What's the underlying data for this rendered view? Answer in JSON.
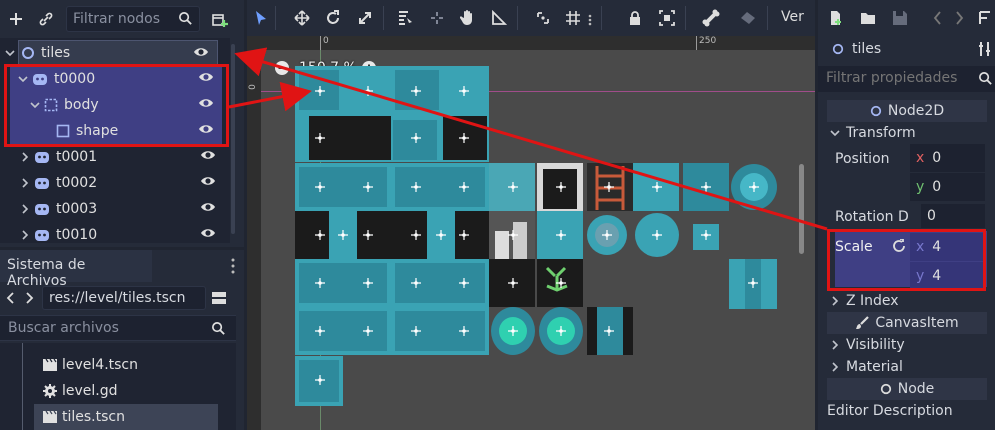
{
  "scene_dock": {
    "filter_placeholder": "Filtrar nodos",
    "tree": [
      {
        "label": "tiles",
        "depth": 0,
        "icon": "node2d-icon"
      },
      {
        "label": "t0000",
        "depth": 1,
        "icon": "kinematic-body-icon"
      },
      {
        "label": "body",
        "depth": 2,
        "icon": "area-icon"
      },
      {
        "label": "shape",
        "depth": 3,
        "icon": "collision-shape-icon"
      },
      {
        "label": "t0001",
        "depth": 1,
        "icon": "kinematic-body-icon"
      },
      {
        "label": "t0002",
        "depth": 1,
        "icon": "kinematic-body-icon"
      },
      {
        "label": "t0003",
        "depth": 1,
        "icon": "kinematic-body-icon"
      },
      {
        "label": "t0010",
        "depth": 1,
        "icon": "kinematic-body-icon"
      }
    ]
  },
  "filesystem": {
    "tab_label": "Sistema de Archivos",
    "path": "res://level/tiles.tscn",
    "search_placeholder": "Buscar archivos",
    "files": [
      {
        "label": "level4.tscn",
        "icon": "scene-file-icon"
      },
      {
        "label": "level.gd",
        "icon": "script-gear-icon"
      },
      {
        "label": "tiles.tscn",
        "icon": "scene-file-icon",
        "selected": true
      }
    ]
  },
  "viewport": {
    "toolbar_view_label": "Ver",
    "zoom_label": "150.7 %",
    "ruler_top_label": "250",
    "ruler_left_label": "0",
    "ruler_origin_label": "0"
  },
  "inspector": {
    "node_name": "tiles",
    "filter_placeholder": "Filtrar propiedades",
    "sections": {
      "node2d": "Node2D",
      "transform": "Transform",
      "z_index": "Z Index",
      "canvas_item": "CanvasItem",
      "visibility": "Visibility",
      "material": "Material",
      "node": "Node",
      "editor_description": "Editor Description"
    },
    "position": {
      "label": "Position",
      "x": "0",
      "y": "0"
    },
    "rotation": {
      "label": "Rotation D",
      "value": "0"
    },
    "scale": {
      "label": "Scale",
      "x": "4",
      "y": "4"
    }
  },
  "colors": {
    "accent_red": "#e01414",
    "selection": "#3f3f84",
    "tile_teal": "#3aa3b4"
  }
}
